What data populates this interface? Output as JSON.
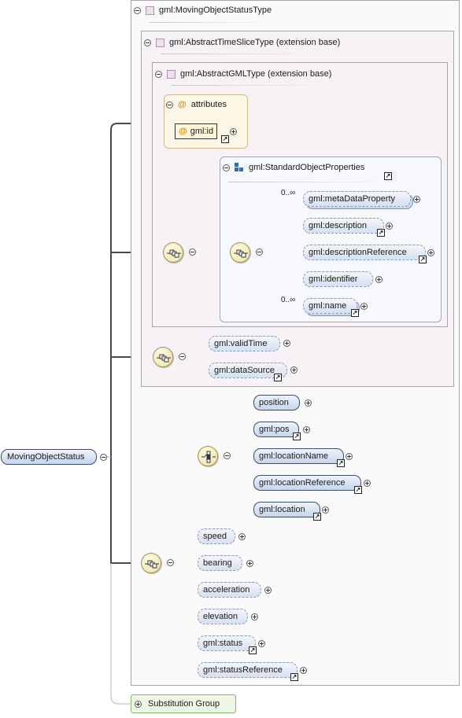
{
  "type_name": "gml:MovingObjectStatusType",
  "time_slice_base": "gml:AbstractTimeSliceType (extension base)",
  "gml_base": "gml:AbstractGMLType (extension base)",
  "attributes": {
    "header": "attributes",
    "id": "gml:id"
  },
  "standard_props": {
    "header": "gml:StandardObjectProperties",
    "elements": [
      {
        "name": "gml:metaDataProperty",
        "occurs": "0..∞"
      },
      {
        "name": "gml:description",
        "occurs": ""
      },
      {
        "name": "gml:descriptionReference",
        "occurs": ""
      },
      {
        "name": "gml:identifier",
        "occurs": ""
      },
      {
        "name": "gml:name",
        "occurs": "0..∞"
      }
    ]
  },
  "time_slice_elements": [
    "gml:validTime",
    "gml:dataSource"
  ],
  "location_choice": [
    "position",
    "gml:pos",
    "gml:locationName",
    "gml:locationReference",
    "gml:location"
  ],
  "status_elements": [
    "speed",
    "bearing",
    "acceleration",
    "elevation",
    "gml:status",
    "gml:statusReference"
  ],
  "root_element": "MovingObjectStatus",
  "substitution_group": "Substitution Group",
  "colors": {
    "element_fill": "#c6d6ee",
    "element_border": "#8296b8",
    "compositor_fill": "#ede1a4",
    "extension_fill": "#f7f2f6",
    "attributes_fill": "#fcf6e6",
    "substitution_fill": "#ecf7e6"
  }
}
